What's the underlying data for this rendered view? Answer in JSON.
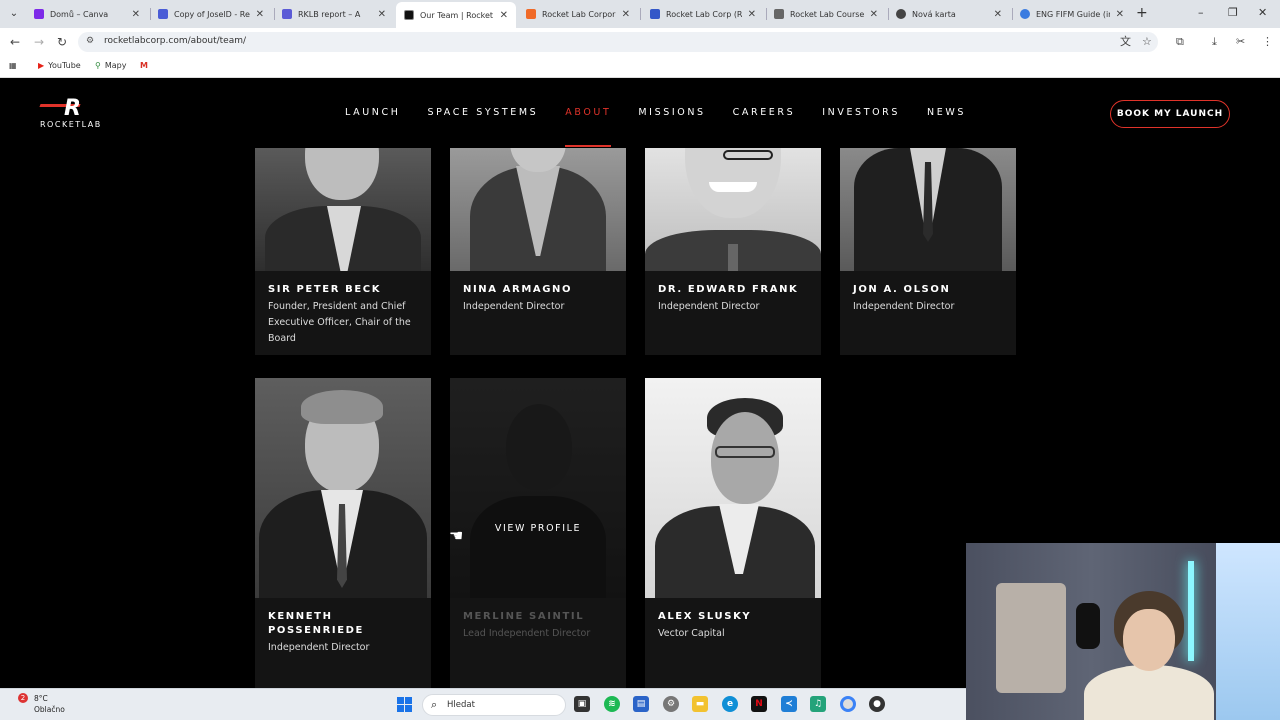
{
  "browser": {
    "tabs": [
      {
        "title": "Domů – Canva",
        "color": "#7d2ae8"
      },
      {
        "title": "Copy of JoselD - Real",
        "color": "#4a5cd6"
      },
      {
        "title": "RKLB report – A",
        "color": "#5b5bd6"
      },
      {
        "title": "Our Team | Rocket La",
        "color": "#111111",
        "active": true
      },
      {
        "title": "Rocket Lab Corporati",
        "color": "#f06a28"
      },
      {
        "title": "Rocket Lab Corp (RKL",
        "color": "#3357c8"
      },
      {
        "title": "Rocket Lab Course Re",
        "color": "#666666"
      },
      {
        "title": "Nová karta",
        "color": "#444444"
      },
      {
        "title": "ENG FIFM Guide (inte",
        "color": "#3a7be0"
      }
    ],
    "url": "rocketlabcorp.com/about/team/",
    "bookmarks": [
      {
        "label": "YouTube",
        "color": "#e62117"
      },
      {
        "label": "Mapy",
        "color": "#2f8a3c"
      },
      {
        "label": "",
        "color": "#d93025"
      }
    ]
  },
  "site": {
    "logo_text": "ROCKETLAB",
    "logo_mark": "R",
    "nav": [
      {
        "label": "LAUNCH"
      },
      {
        "label": "SPACE SYSTEMS"
      },
      {
        "label": "ABOUT",
        "active": true
      },
      {
        "label": "MISSIONS"
      },
      {
        "label": "CAREERS"
      },
      {
        "label": "INVESTORS"
      },
      {
        "label": "NEWS"
      }
    ],
    "cta": "BOOK MY LAUNCH",
    "accent": "#e0332a"
  },
  "team": [
    {
      "name": "SIR PETER BECK",
      "role": "Founder, President and Chief Executive Officer, Chair of the Board"
    },
    {
      "name": "NINA ARMAGNO",
      "role": "Independent Director"
    },
    {
      "name": "DR. EDWARD FRANK",
      "role": "Independent Director"
    },
    {
      "name": "JON A. OLSON",
      "role": "Independent Director"
    },
    {
      "name": "KENNETH POSSENRIEDE",
      "role": "Independent Director"
    },
    {
      "name": "MERLINE SAINTIL",
      "role": "Lead Independent Director",
      "hover": true,
      "hover_label": "VIEW PROFILE"
    },
    {
      "name": "ALEX SLUSKY",
      "role": "Vector Capital"
    }
  ],
  "taskbar": {
    "weather_temp": "8°C",
    "weather_desc": "Oblačno",
    "notification_count": "2",
    "search_placeholder": "Hledat"
  }
}
